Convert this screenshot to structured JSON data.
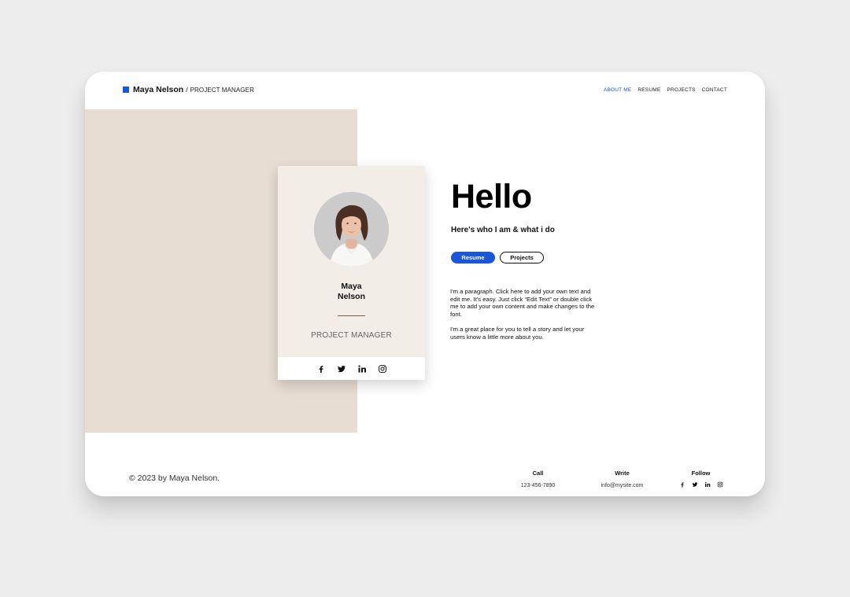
{
  "header": {
    "brand_name": "Maya Nelson",
    "brand_separator": "/",
    "brand_role": "PROJECT MANAGER",
    "nav": [
      "ABOUT ME",
      "RESUME",
      "PROJECTS",
      "CONTACT"
    ],
    "active_nav": "ABOUT ME"
  },
  "card": {
    "first_name": "Maya",
    "last_name": "Nelson",
    "role": "PROJECT MANAGER",
    "social_icons": [
      "facebook-icon",
      "twitter-icon",
      "linkedin-icon",
      "instagram-icon"
    ]
  },
  "hero": {
    "title": "Hello",
    "subtitle": "Here's who I am & what i do",
    "resume_button": "Resume",
    "projects_button": "Projects",
    "paragraph1": "I'm a paragraph. Click here to add your own text and edit me. It's easy. Just click “Edit Text” or double click me to add your own content and make changes to the font.",
    "paragraph2": "I'm a great place for you to tell a story and let your users know a little more about you."
  },
  "footer": {
    "copyright": "© 2023 by Maya Nelson.",
    "call_title": "Call",
    "call_value": "123-456-7890",
    "write_title": "Write",
    "write_value": "info@mysite.com",
    "follow_title": "Follow"
  },
  "colors": {
    "accent": "#1a56d6",
    "beige_panel": "#e7ddd2",
    "card_background": "#f2ede7",
    "page_background": "#ededed"
  }
}
